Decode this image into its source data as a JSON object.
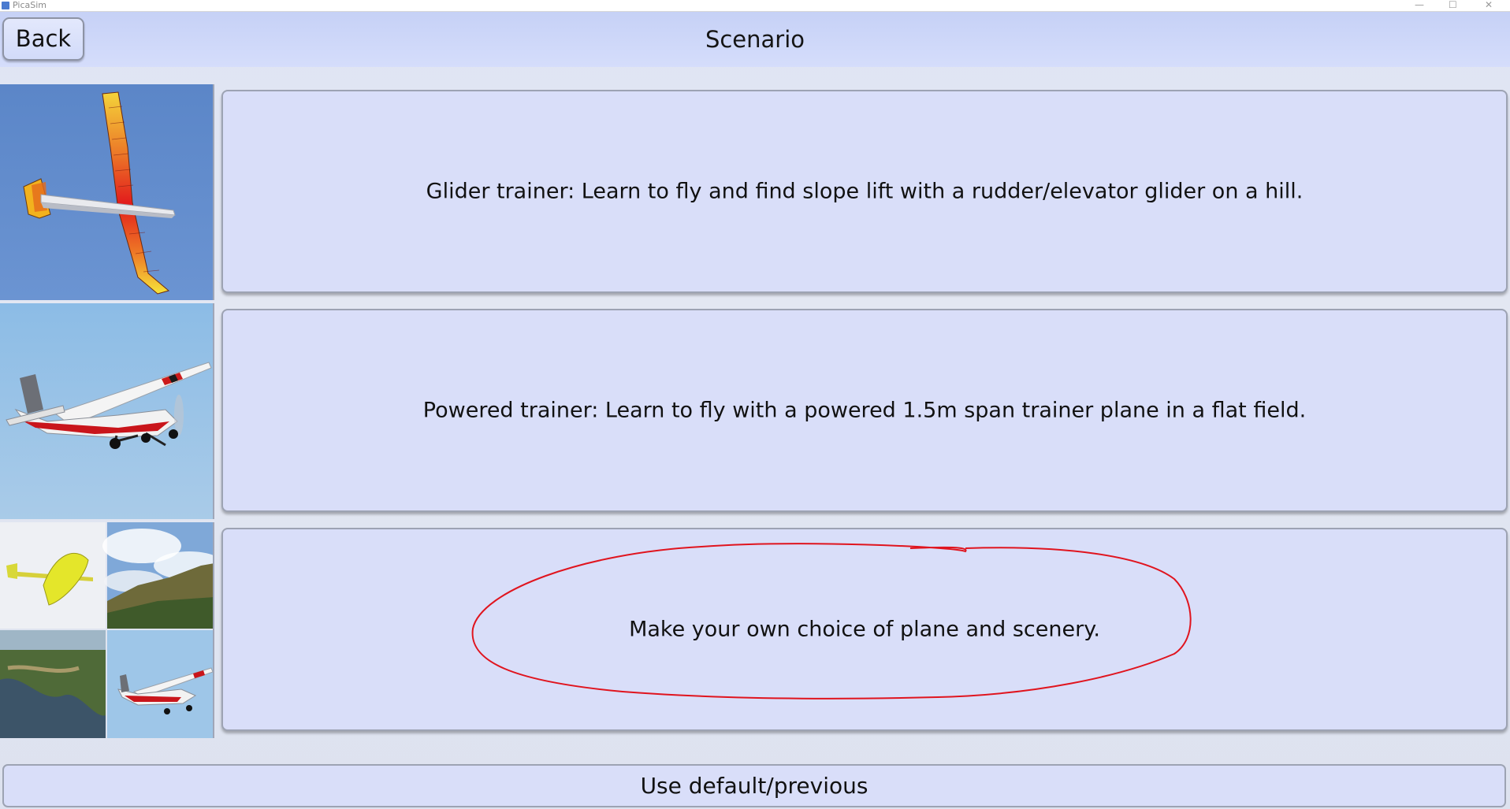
{
  "window": {
    "title": "PicaSim",
    "controls": {
      "minimize": "—",
      "maximize": "☐",
      "close": "✕"
    }
  },
  "header": {
    "back_label": "Back",
    "title": "Scenario"
  },
  "scenarios": [
    {
      "label": "Glider trainer: Learn to fly and find slope lift with a rudder/elevator glider on a hill.",
      "icon": "glider-plane-image"
    },
    {
      "label": "Powered trainer: Learn to fly with a powered 1.5m span trainer plane in a flat field.",
      "icon": "powered-plane-image"
    },
    {
      "label": "Make your own choice of plane and scenery.",
      "icon": "custom-choice-collage"
    }
  ],
  "footer": {
    "default_label": "Use default/previous"
  },
  "colors": {
    "annotation": "#e0141e",
    "button_fill": "#d9def9",
    "header_fill": "#c9d4f7"
  }
}
